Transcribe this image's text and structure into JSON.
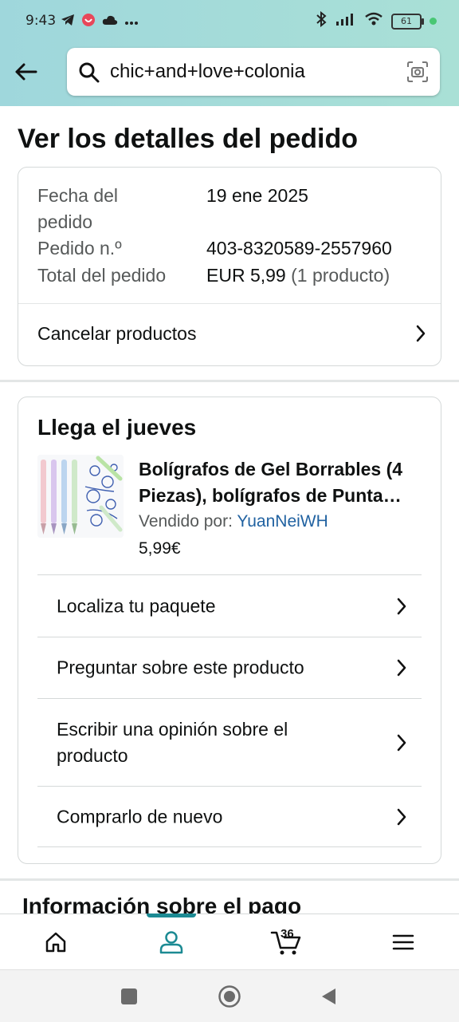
{
  "status_bar": {
    "time": "9:43",
    "battery": "61"
  },
  "search": {
    "query": "chic+and+love+colonia"
  },
  "page": {
    "title": "Ver los detalles del pedido"
  },
  "order": {
    "date_label_line1": "Fecha del",
    "date_label_line2": "pedido",
    "date_value": "19 ene 2025",
    "number_label": "Pedido n.º",
    "number_value": "403-8320589-2557960",
    "total_label": "Total del pedido",
    "total_value": "EUR 5,99",
    "total_count": "(1 producto)",
    "cancel_label": "Cancelar productos"
  },
  "shipment": {
    "arrival": "Llega el jueves",
    "product_title": "Bolígrafos de Gel Borrables (4 Piezas), bolígrafos de Punta…",
    "seller_label": "Vendido por:",
    "seller_name": "YuanNeiWH",
    "price": "5,99€",
    "actions": [
      {
        "label": "Localiza tu paquete"
      },
      {
        "label": "Preguntar sobre este producto"
      },
      {
        "label": "Escribir una opinión sobre el producto"
      },
      {
        "label": "Comprarlo de nuevo"
      }
    ]
  },
  "payment": {
    "heading": "Información sobre el pago"
  },
  "tabbar": {
    "cart_count": "36",
    "active_tab": "account",
    "accent": "#1c8a93"
  }
}
